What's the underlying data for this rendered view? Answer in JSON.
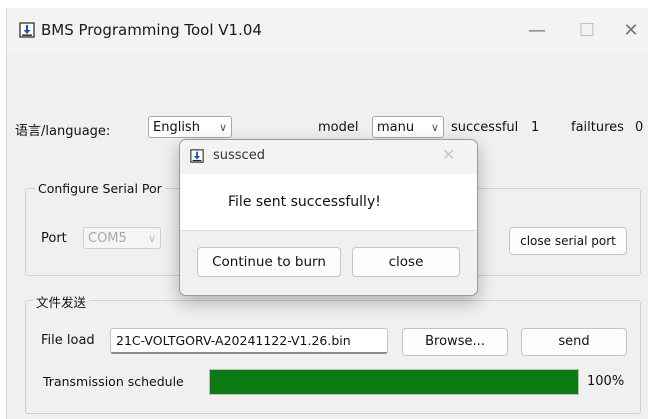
{
  "window": {
    "title": "BMS Programming Tool V1.04",
    "minimize_glyph": "—",
    "maximize_glyph": "☐",
    "close_glyph": "✕"
  },
  "top_bar": {
    "language_label": "语言/language:",
    "language_value": "English",
    "model_label": "model",
    "model_value": "manu",
    "successful_label": "successful",
    "successful_count": "1",
    "failures_label": "failtures",
    "failures_count": "0"
  },
  "serial_group": {
    "title": "Configure Serial Por",
    "port_label": "Port",
    "port_value": "COM5",
    "close_port_button": "close serial port"
  },
  "send_group": {
    "title": "文件发送",
    "file_load_label": "File load",
    "file_name": "21C-VOLTGORV-A20241122-V1.26.bin",
    "browse_button": "Browse...",
    "send_button": "send",
    "schedule_label": "Transmission schedule",
    "progress_percent": 100,
    "progress_text": "100%"
  },
  "dialog": {
    "title": "sussced",
    "message": "File sent successfully!",
    "continue_button": "Continue to burn",
    "close_button": "close",
    "close_glyph": "✕"
  },
  "icons": {
    "app_icon": "download-arrow-icon",
    "accent_color": "#0e7a13"
  }
}
